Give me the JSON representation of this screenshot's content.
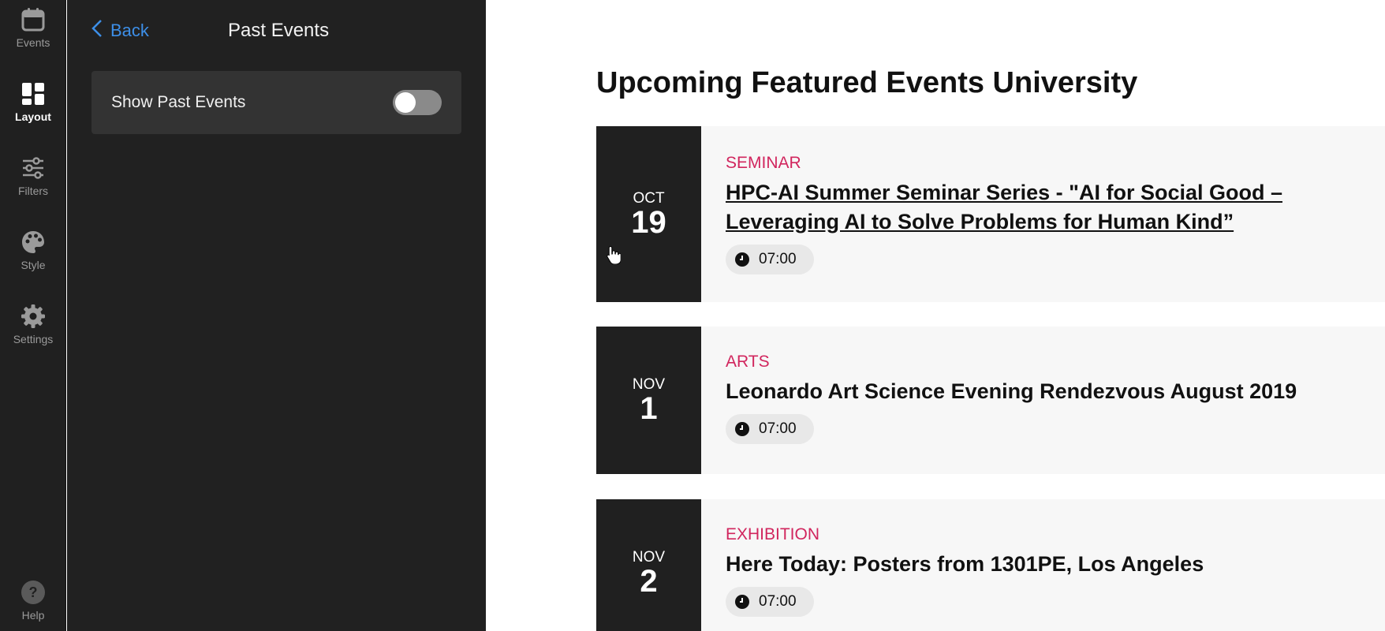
{
  "rail": {
    "items": [
      {
        "label": "Events",
        "icon": "calendar-icon",
        "active": false
      },
      {
        "label": "Layout",
        "icon": "layout-icon",
        "active": true
      },
      {
        "label": "Filters",
        "icon": "sliders-icon",
        "active": false
      },
      {
        "label": "Style",
        "icon": "palette-icon",
        "active": false
      },
      {
        "label": "Settings",
        "icon": "gear-icon",
        "active": false
      }
    ],
    "help_label": "Help"
  },
  "panel": {
    "back_label": "Back",
    "title": "Past Events",
    "toggle_label": "Show Past Events",
    "toggle_on": false
  },
  "main": {
    "heading": "Upcoming Featured Events University",
    "events": [
      {
        "month": "OCT",
        "day": "19",
        "category": "SEMINAR",
        "title": "HPC-AI Summer Seminar Series - \"AI for Social Good – Leveraging AI to Solve Problems for Human Kind”",
        "time": "07:00"
      },
      {
        "month": "NOV",
        "day": "1",
        "category": "ARTS",
        "title": "Leonardo Art Science Evening Rendezvous August 2019",
        "time": "07:00"
      },
      {
        "month": "NOV",
        "day": "2",
        "category": "EXHIBITION",
        "title": "Here Today: Posters from 1301PE, Los Angeles",
        "time": "07:00"
      }
    ]
  },
  "colors": {
    "accent_link": "#3d8fe8",
    "category": "#d1265e",
    "rail_bg": "#202020",
    "panel_bg": "#212121"
  }
}
